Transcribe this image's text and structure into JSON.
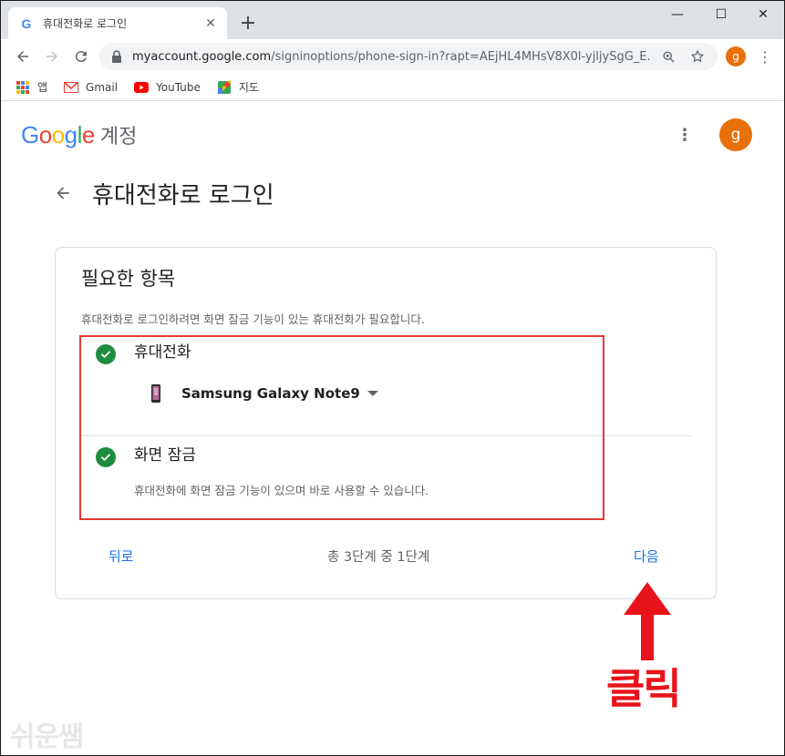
{
  "tab": {
    "favicon": "G",
    "title": "휴대전화로 로그인",
    "close": "✕"
  },
  "window": {
    "new_tab": "+",
    "minimize": "—",
    "maximize": "☐",
    "close": "✕"
  },
  "toolbar": {
    "url_host": "myaccount.google.com",
    "url_rest": "/signinoptions/phone-sign-in?rapt=AEjHL4MHsV8X0l-yjljySgG_E...",
    "avatar_letter": "g",
    "menu": "⋮"
  },
  "bookmarks": [
    {
      "label": "앱",
      "icon": "apps-icon"
    },
    {
      "label": "Gmail",
      "icon": "gmail-icon"
    },
    {
      "label": "YouTube",
      "icon": "youtube-icon"
    },
    {
      "label": "지도",
      "icon": "maps-icon"
    }
  ],
  "page": {
    "logo_letters": [
      "G",
      "o",
      "o",
      "g",
      "l",
      "e"
    ],
    "logo_product": "계정",
    "kebab": "⋮",
    "avatar_letter": "g",
    "heading": "휴대전화로 로그인"
  },
  "card": {
    "title": "필요한 항목",
    "description": "휴대전화로 로그인하려면 화면 잠금 기능이 있는 휴대전화가 필요합니다.",
    "phone_label": "휴대전화",
    "device_name": "Samsung Galaxy Note9",
    "lock_label": "화면 잠금",
    "lock_desc": "휴대전화에 화면 잠금 기능이 있으며 바로 사용할 수 있습니다.",
    "back": "뒤로",
    "step": "총 3단계 중 1단계",
    "next": "다음"
  },
  "annotation": {
    "click_label": "클릭"
  },
  "watermark": "쉬운쌤",
  "colors": {
    "google_blue": "#4285f4",
    "google_red": "#ea4335",
    "google_yellow": "#fbbc05",
    "google_green": "#34a853",
    "link_blue": "#1a73e8",
    "check_green": "#1e8e3e",
    "avatar_orange": "#e8710a",
    "annotation_red": "#e8141b"
  }
}
